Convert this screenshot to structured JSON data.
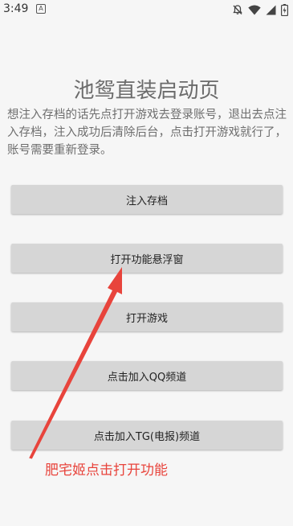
{
  "status_bar": {
    "time": "3:49",
    "notif_glyph": "A",
    "icons": [
      "notifications-off-icon",
      "wifi-icon",
      "cellular-signal-icon",
      "battery-charging-icon"
    ]
  },
  "page": {
    "title": "池鸳直装启动页",
    "description": "想注入存档的话先点打开游戏去登录账号，退出去点注入存档，注入成功后清除后台，点击打开游戏就行了，账号需要重新登录。"
  },
  "buttons": {
    "inject_save": "注入存档",
    "open_floating_window": "打开功能悬浮窗",
    "open_game": "打开游戏",
    "join_qq_channel": "点击加入QQ频道",
    "join_tg_channel": "点击加入TG(电报)频道"
  },
  "annotation": {
    "text": "肥宅姬点击打开功能",
    "color": "#e8443c"
  },
  "colors": {
    "background": "#f6f6f6",
    "button": "#d6d6d6",
    "title_text": "#6b6b6b",
    "annotation": "#e8443c"
  }
}
